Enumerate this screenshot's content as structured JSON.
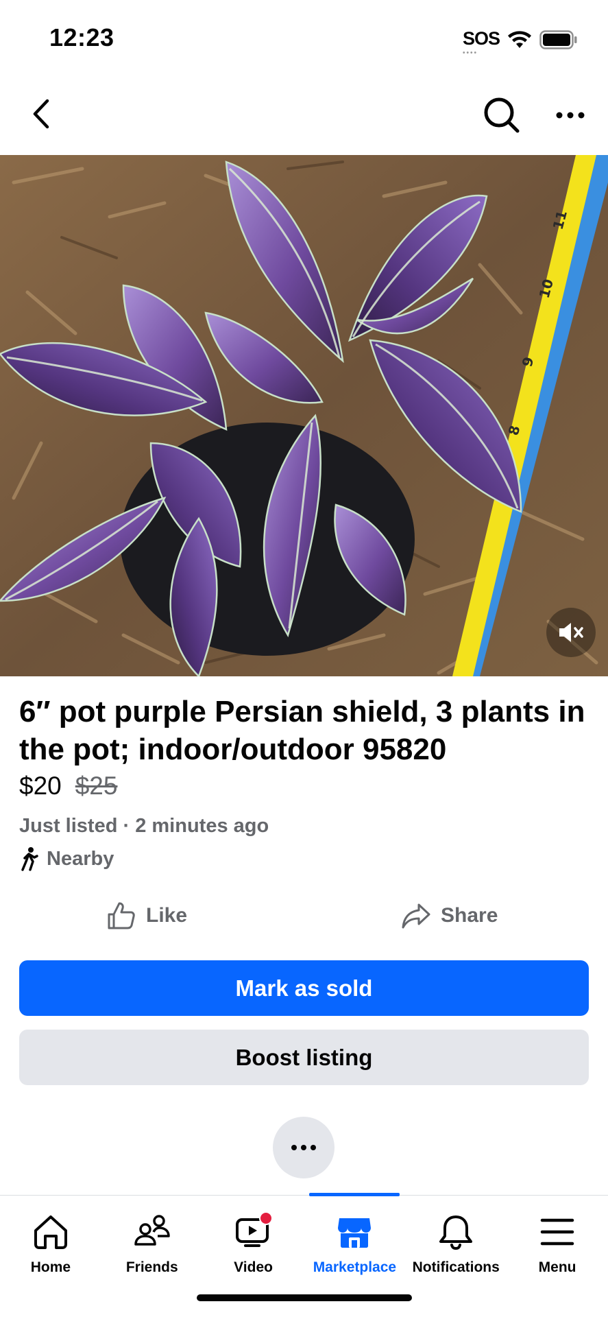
{
  "status_bar": {
    "time": "12:23",
    "carrier": "SOS",
    "icons": [
      "wifi-icon",
      "battery-icon"
    ]
  },
  "nav": {
    "icons": [
      "back-chevron-icon",
      "search-icon",
      "more-horizontal-icon"
    ]
  },
  "listing": {
    "photo_subject": "purple-persian-shield-plant",
    "title": "6″ pot purple Persian shield, 3 plants in the pot; indoor/outdoor 95820",
    "price": "$20",
    "original_price": "$25",
    "listed": "Just listed · 2 minutes ago",
    "location": "Nearby"
  },
  "actions": {
    "like": "Like",
    "share": "Share"
  },
  "buttons": {
    "mark_sold": "Mark as sold",
    "boost": "Boost listing"
  },
  "tabs": [
    {
      "label": "Home",
      "icon": "home-icon"
    },
    {
      "label": "Friends",
      "icon": "friends-icon"
    },
    {
      "label": "Video",
      "icon": "video-icon",
      "badge": true
    },
    {
      "label": "Marketplace",
      "icon": "marketplace-icon",
      "active": true
    },
    {
      "label": "Notifications",
      "icon": "bell-icon"
    },
    {
      "label": "Menu",
      "icon": "menu-icon"
    }
  ],
  "colors": {
    "accent": "#0866ff",
    "secondary_button": "#e4e6eb",
    "badge": "#e41e3f",
    "muted_text": "#65676b"
  }
}
